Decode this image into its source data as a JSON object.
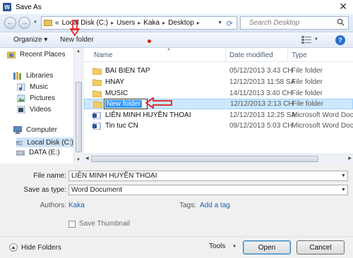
{
  "window": {
    "title": "Save As",
    "app_icon": "W",
    "close_glyph": "✕"
  },
  "address_bar": {
    "back_glyph": "←",
    "forward_glyph": "→",
    "chevrons": "«",
    "crumbs": [
      "Local Disk (C:)",
      "Users",
      "Kaka",
      "Desktop"
    ],
    "separator": "▸",
    "refresh_glyph": "⟳"
  },
  "search": {
    "placeholder": "Search Desktop"
  },
  "toolbar": {
    "organize_label": "Organize ▾",
    "new_folder_label": "New folder"
  },
  "navigation": {
    "recent_places": "Recent Places",
    "libraries": "Libraries",
    "library_items": [
      "Music",
      "Pictures",
      "Videos"
    ],
    "computer": "Computer",
    "drives": [
      "Local Disk (C:)",
      "DATA (E:)"
    ]
  },
  "columns": {
    "name": "Name",
    "date_modified": "Date modified",
    "type": "Type"
  },
  "files": [
    {
      "name": "BAI BIEN TAP",
      "date": "05/12/2013 3:43 CH",
      "type": "File folder",
      "icon": "folder-icon"
    },
    {
      "name": "HNAY",
      "date": "12/12/2013 11:58 SA",
      "type": "File folder",
      "icon": "folder-icon"
    },
    {
      "name": "MUSIC",
      "date": "14/11/2013 3:40 CH",
      "type": "File folder",
      "icon": "folder-icon"
    },
    {
      "name": "New folder",
      "date": "12/12/2013 2:13 CH",
      "type": "File folder",
      "icon": "folder-icon",
      "editing": true
    },
    {
      "name": "LIÊN MINH HUYỀN THOẠI",
      "date": "12/12/2013 12:25 SA",
      "type": "Microsoft Word Doc",
      "icon": "word-doc-icon"
    },
    {
      "name": "Tin tuc CN",
      "date": "09/12/2013 5:03 CH",
      "type": "Microsoft Word Doc",
      "icon": "word-doc-icon"
    }
  ],
  "form": {
    "file_name_label": "File name:",
    "file_name_value": "LIÊN MINH HUYỀN THOẠI",
    "save_type_label": "Save as type:",
    "save_type_value": "Word Document",
    "authors_label": "Authors:",
    "authors_value": "Kaka",
    "tags_label": "Tags:",
    "tags_value": "Add a tag",
    "thumbnail_label": "Save Thumbnail",
    "thumbnail_checked": false
  },
  "footer": {
    "hide_folders_label": "Hide Folders",
    "tools_label": "Tools",
    "open_label": "Open",
    "cancel_label": "Cancel"
  },
  "colors": {
    "selection": "#cce8ff",
    "edit_highlight": "#3399ff",
    "annotation_red": "#e21b1b",
    "link_blue": "#1a5fb4"
  }
}
